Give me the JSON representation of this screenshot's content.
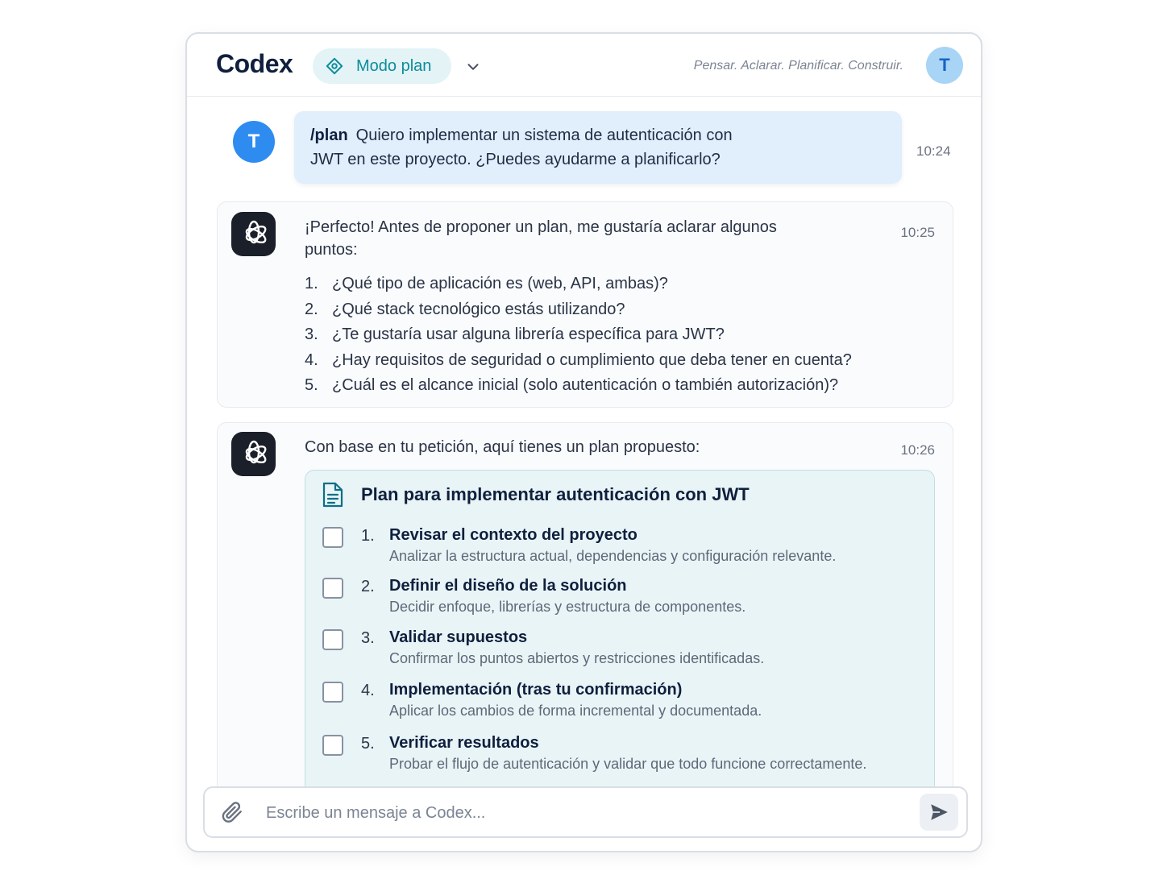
{
  "app": {
    "name": "Codex",
    "mode_label": "Modo plan",
    "tagline": "Pensar. Aclarar. Planificar. Construir.",
    "user_initial": "T",
    "accent_color": "#0e8c9b"
  },
  "messages": {
    "user": {
      "avatar_initial": "T",
      "command": "/plan",
      "text_line1": "Quiero implementar un sistema de autenticación con",
      "text_line2": "JWT en este proyecto. ¿Puedes ayudarme a planificarlo?",
      "time": "10:24"
    },
    "assistant1": {
      "time": "10:25",
      "intro_line1": "¡Perfecto! Antes de proponer un plan, me gustaría aclarar algunos",
      "intro_line2": "puntos:",
      "questions": [
        {
          "num": "1.",
          "text": "¿Qué tipo de aplicación es (web, API, ambas)?"
        },
        {
          "num": "2.",
          "text": "¿Qué stack tecnológico estás utilizando?"
        },
        {
          "num": "3.",
          "text": "¿Te gustaría usar alguna librería específica para JWT?"
        },
        {
          "num": "4.",
          "text": "¿Hay requisitos de seguridad o cumplimiento que deba tener en cuenta?"
        },
        {
          "num": "5.",
          "text": "¿Cuál es el alcance inicial (solo autenticación o también autorización)?"
        }
      ]
    },
    "assistant2": {
      "time": "10:26",
      "intro": "Con base en tu petición, aquí tienes un plan propuesto:",
      "plan": {
        "title": "Plan para implementar autenticación con JWT",
        "steps": [
          {
            "num": "1.",
            "title": "Revisar el contexto del proyecto",
            "desc": "Analizar la estructura actual, dependencias y configuración relevante.",
            "checked": false
          },
          {
            "num": "2.",
            "title": "Definir el diseño de la solución",
            "desc": "Decidir enfoque, librerías y estructura de componentes.",
            "checked": false
          },
          {
            "num": "3.",
            "title": "Validar supuestos",
            "desc": "Confirmar los puntos abiertos y restricciones identificadas.",
            "checked": false
          },
          {
            "num": "4.",
            "title": "Implementación (tras tu confirmación)",
            "desc": "Aplicar los cambios de forma incremental y documentada.",
            "checked": false
          },
          {
            "num": "5.",
            "title": "Verificar resultados",
            "desc": "Probar el flujo de autenticación y validar que todo funcione correctamente.",
            "checked": false
          }
        ]
      }
    }
  },
  "composer": {
    "placeholder": "Escribe un mensaje a Codex...",
    "value": ""
  },
  "icons": {
    "mode": "target-icon",
    "dropdown": "chevron-down-icon",
    "assistant": "openai-logo-icon",
    "plan": "document-icon",
    "attach": "paperclip-icon",
    "send": "send-icon"
  }
}
